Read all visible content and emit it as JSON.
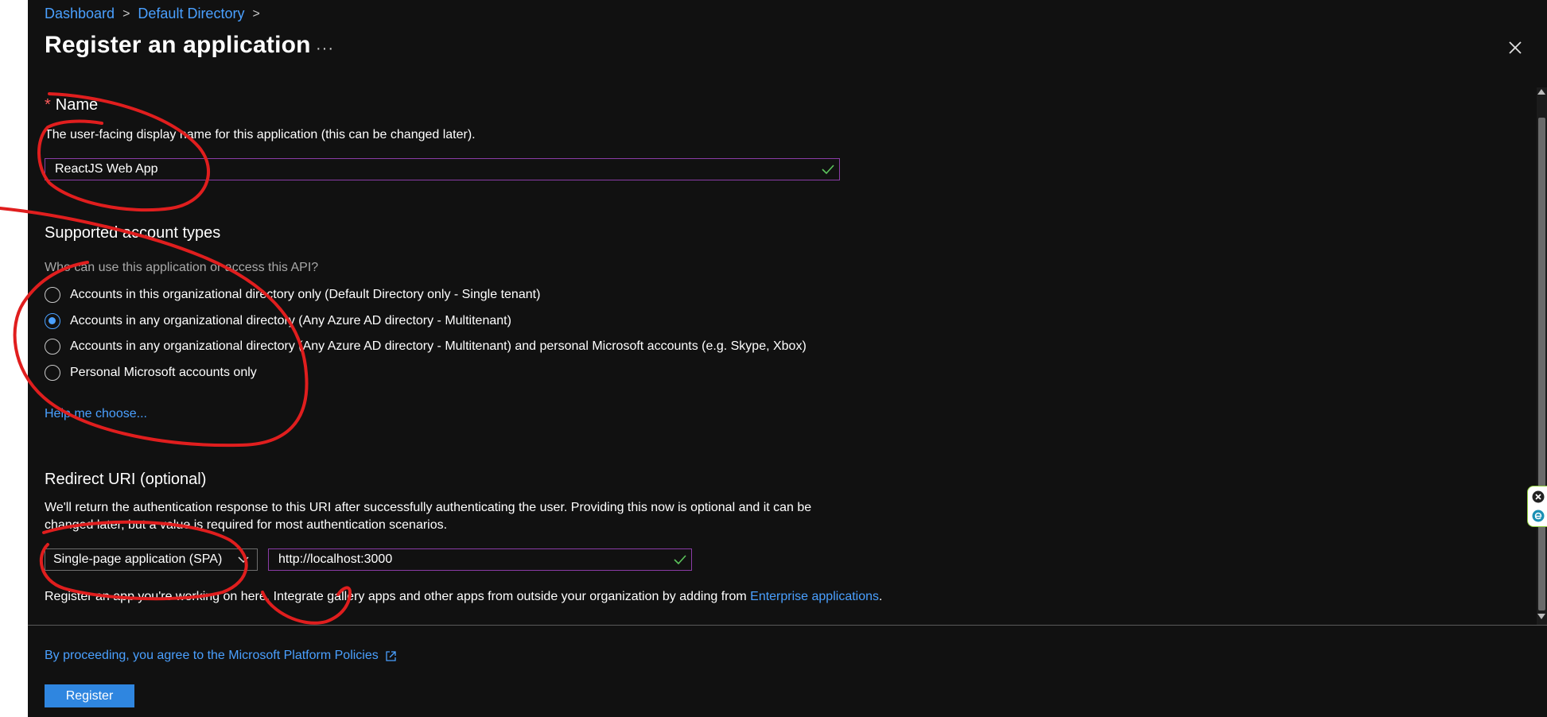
{
  "breadcrumb": {
    "items": [
      {
        "label": "Dashboard"
      },
      {
        "label": "Default Directory"
      }
    ]
  },
  "header": {
    "title": "Register an application",
    "more_label": "···"
  },
  "name_section": {
    "heading": "Name",
    "required_mark": "*",
    "description": "The user-facing display name for this application (this can be changed later).",
    "value": "ReactJS Web App"
  },
  "account_types": {
    "heading": "Supported account types",
    "question": "Who can use this application or access this API?",
    "options": [
      {
        "label": "Accounts in this organizational directory only (Default Directory only - Single tenant)",
        "selected": false
      },
      {
        "label": "Accounts in any organizational directory (Any Azure AD directory - Multitenant)",
        "selected": true
      },
      {
        "label": "Accounts in any organizational directory (Any Azure AD directory - Multitenant) and personal Microsoft accounts (e.g. Skype, Xbox)",
        "selected": false
      },
      {
        "label": "Personal Microsoft accounts only",
        "selected": false
      }
    ],
    "help_link": "Help me choose..."
  },
  "redirect": {
    "heading": "Redirect URI (optional)",
    "description_line1": "We'll return the authentication response to this URI after successfully authenticating the user. Providing this now is optional and it can be",
    "description_line2": "changed later, but a value is required for most authentication scenarios.",
    "platform_value": "Single-page application (SPA)",
    "uri_value": "http://localhost:3000",
    "note_prefix": "Register an app you're working on here. Integrate gallery apps and other apps from outside your organization by adding from ",
    "note_link": "Enterprise applications",
    "note_suffix": "."
  },
  "footer": {
    "policy_link": "By proceeding, you agree to the Microsoft Platform Policies",
    "register_label": "Register"
  },
  "colors": {
    "background": "#111111",
    "accent": "#4aa0ff",
    "button": "#2f86e0",
    "input_border": "#8a3ca6",
    "valid_check": "#5cc45c",
    "annotation": "#e01e1e"
  }
}
